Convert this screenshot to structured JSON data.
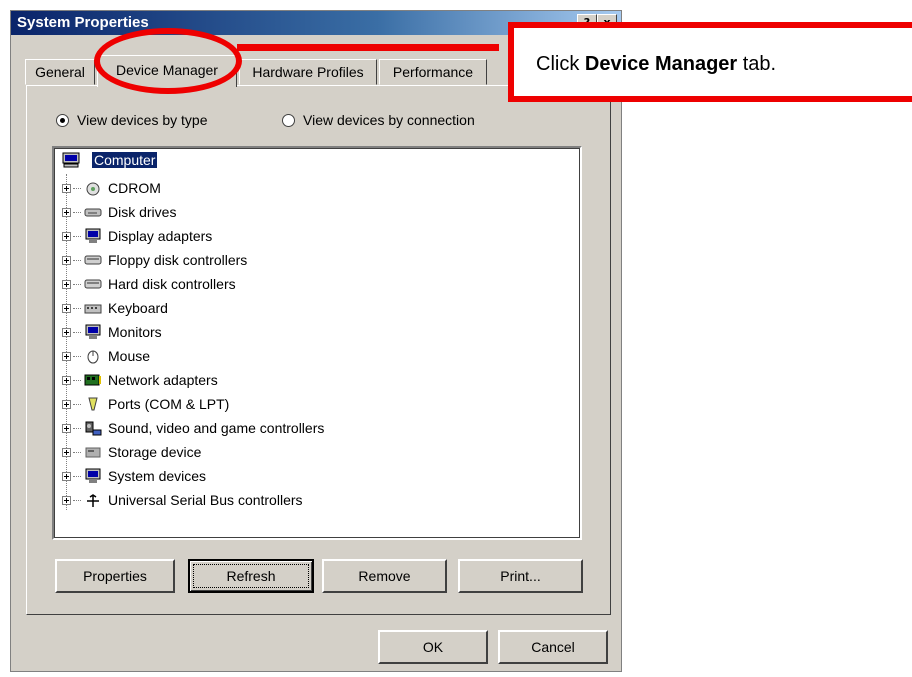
{
  "window": {
    "title": "System Properties",
    "help_btn": "?",
    "close_btn": "x"
  },
  "tabs": [
    {
      "label": "General"
    },
    {
      "label": "Device Manager",
      "active": true
    },
    {
      "label": "Hardware Profiles"
    },
    {
      "label": "Performance"
    }
  ],
  "view": {
    "by_type": "View devices by type",
    "by_connection": "View devices by connection",
    "selected": "by_type"
  },
  "tree": {
    "root": "Computer",
    "items": [
      {
        "label": "CDROM",
        "icon": "cdrom-icon"
      },
      {
        "label": "Disk drives",
        "icon": "disk-drive-icon"
      },
      {
        "label": "Display adapters",
        "icon": "monitor-icon"
      },
      {
        "label": "Floppy disk controllers",
        "icon": "disk-controller-icon"
      },
      {
        "label": "Hard disk controllers",
        "icon": "disk-controller-icon"
      },
      {
        "label": "Keyboard",
        "icon": "keyboard-icon"
      },
      {
        "label": "Monitors",
        "icon": "monitor-icon"
      },
      {
        "label": "Mouse",
        "icon": "mouse-icon"
      },
      {
        "label": "Network adapters",
        "icon": "network-card-icon"
      },
      {
        "label": "Ports (COM & LPT)",
        "icon": "port-icon"
      },
      {
        "label": "Sound, video and game controllers",
        "icon": "sound-icon"
      },
      {
        "label": "Storage device",
        "icon": "storage-icon"
      },
      {
        "label": "System devices",
        "icon": "monitor-icon"
      },
      {
        "label": "Universal Serial Bus controllers",
        "icon": "usb-icon"
      }
    ]
  },
  "buttons": {
    "properties": "Properties",
    "refresh": "Refresh",
    "remove": "Remove",
    "print": "Print...",
    "ok": "OK",
    "cancel": "Cancel"
  },
  "callout": {
    "pre": "Click ",
    "bold": "Device Manager",
    "post": " tab."
  },
  "colors": {
    "annotation": "#ee0000",
    "selection": "#0a246a",
    "dialog": "#d4d0c8"
  }
}
